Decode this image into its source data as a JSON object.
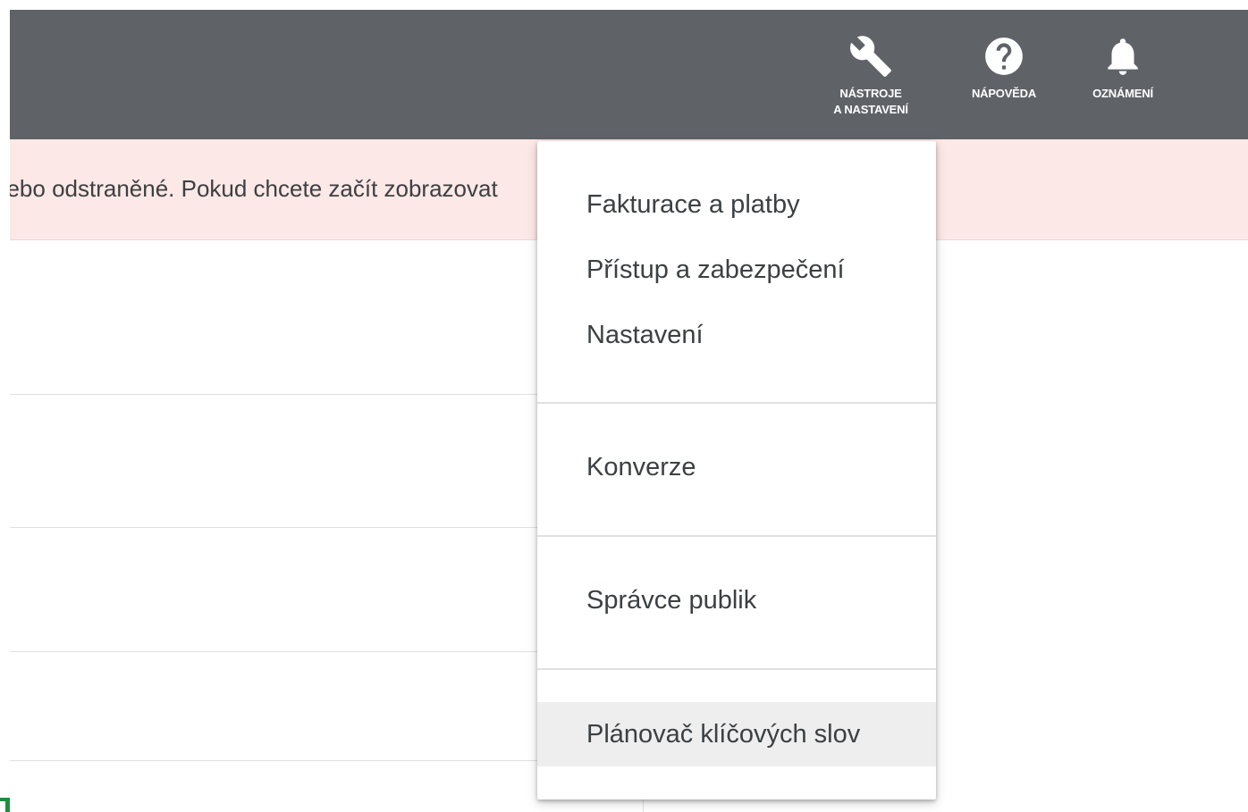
{
  "header": {
    "tools": {
      "line1": "NÁSTROJE",
      "line2": "A NASTAVENÍ",
      "icon": "wrench-icon"
    },
    "help": {
      "label": "NÁPOVĚDA",
      "icon": "help-circle-icon"
    },
    "notifications": {
      "label": "OZNÁMENÍ",
      "icon": "bell-icon"
    },
    "background_color": "#5f6368"
  },
  "notice": {
    "text": "nebo odstraněné. Pokud chcete začít zobrazovat",
    "background_color": "#fce8e6"
  },
  "menu": {
    "groups": [
      {
        "items": [
          {
            "label": "Fakturace a platby"
          },
          {
            "label": "Přístup a zabezpečení"
          },
          {
            "label": "Nastavení"
          }
        ]
      },
      {
        "items": [
          {
            "label": "Konverze"
          }
        ]
      },
      {
        "items": [
          {
            "label": "Správce publik"
          }
        ]
      },
      {
        "items": [
          {
            "label": "Plánovač klíčových slov",
            "highlighted": true
          }
        ]
      }
    ]
  }
}
